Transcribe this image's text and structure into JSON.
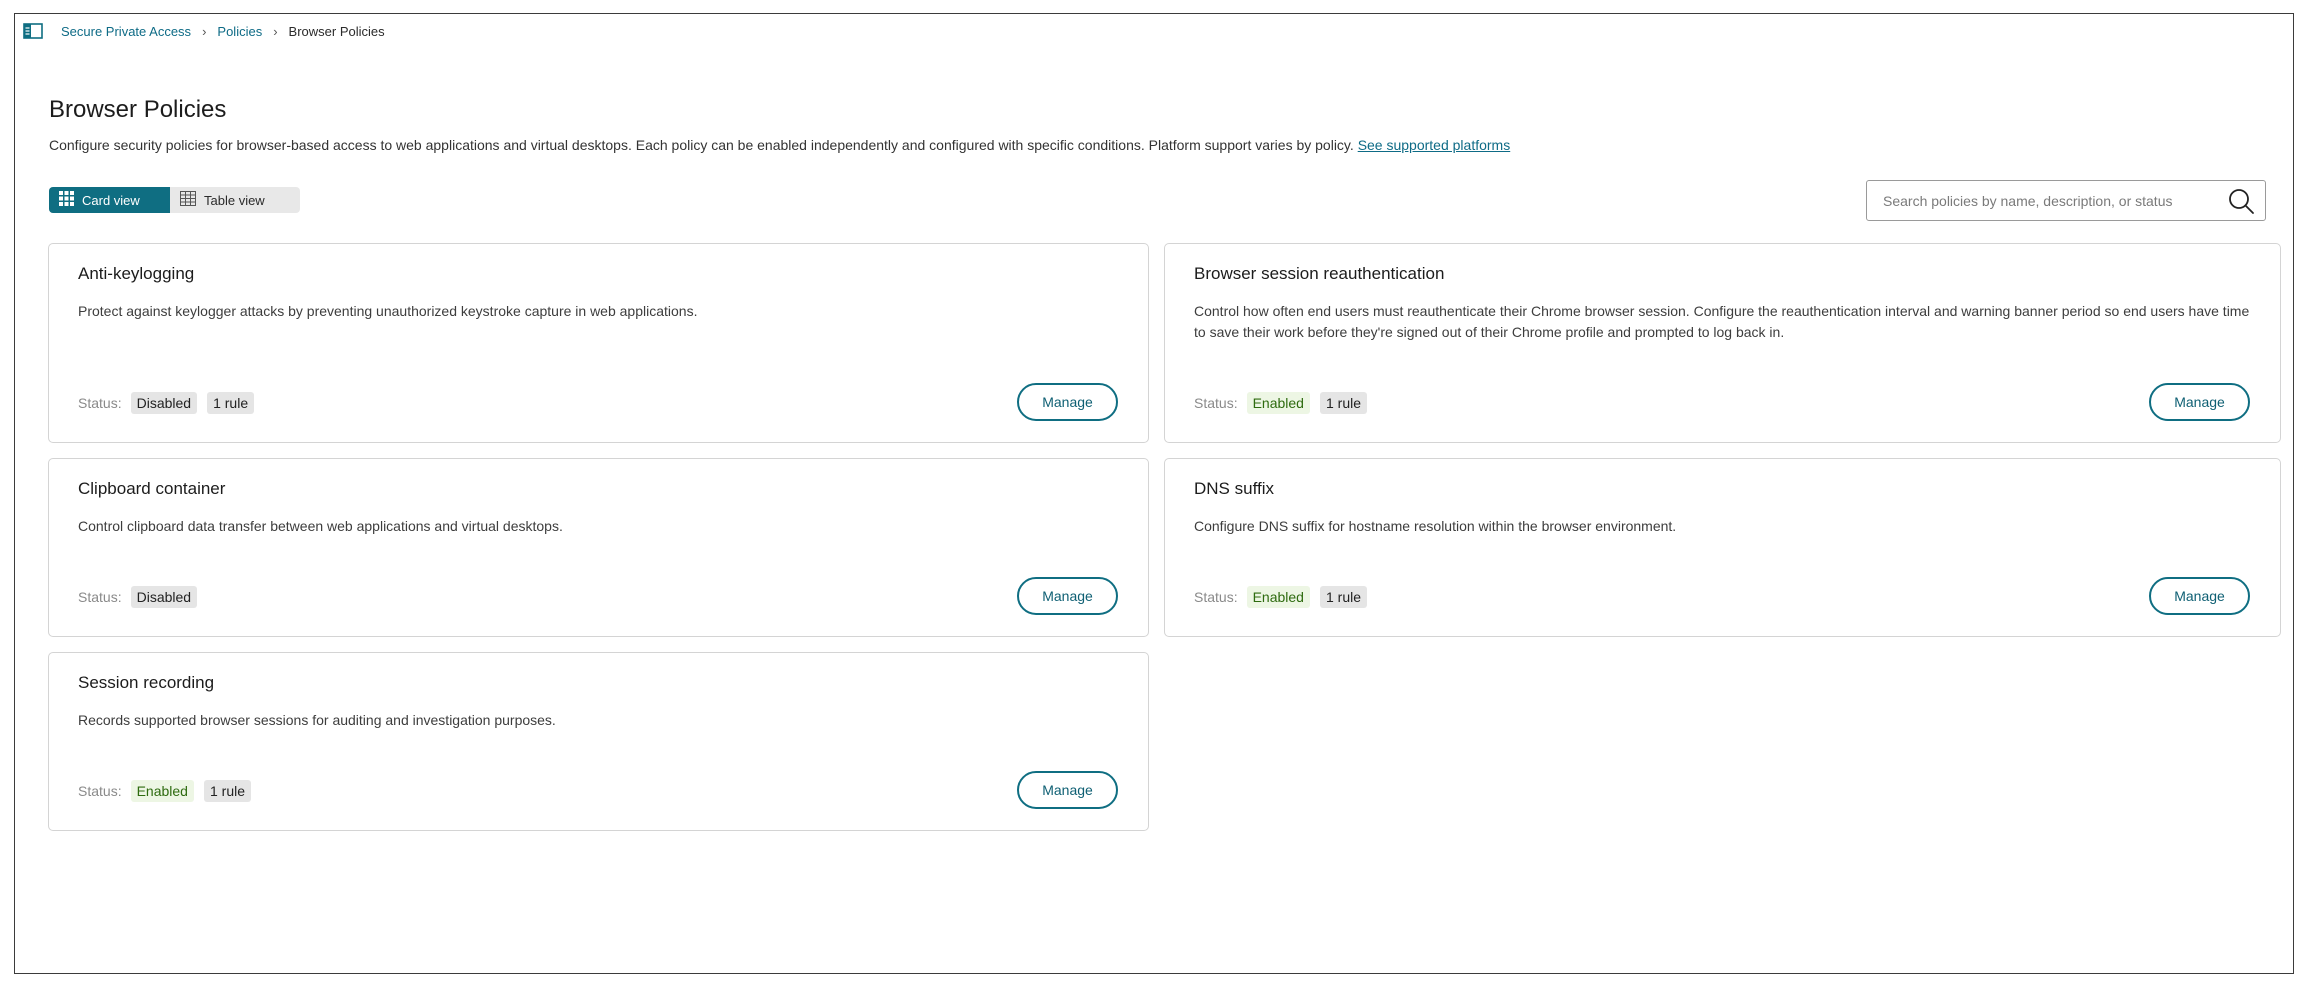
{
  "breadcrumb": {
    "items": [
      "Secure Private Access",
      "Policies"
    ],
    "current": "Browser Policies",
    "separator": "›"
  },
  "page": {
    "title": "Browser Policies",
    "description": "Configure security policies for browser-based access to web applications and virtual desktops. Each policy can be enabled independently and configured with specific conditions. Platform support varies by policy.",
    "link": "See supported platforms"
  },
  "view_toggle": {
    "card_label": "Card view",
    "table_label": "Table view",
    "selected": "Card view"
  },
  "search": {
    "placeholder": "Search policies by name, description, or status"
  },
  "status_label": "Status:",
  "manage_label": "Manage",
  "cards": [
    {
      "title": "Anti-keylogging",
      "description": "Protect against keylogger attacks by preventing unauthorized keystroke capture in web applications.",
      "status": "Disabled",
      "rules": "1 rule"
    },
    {
      "title": "Browser session reauthentication",
      "description": "Control how often end users must reauthenticate their Chrome browser session. Configure the reauthentication interval and warning banner period so end users have time to save their work before they're signed out of their Chrome profile and prompted to log back in.",
      "status": "Enabled",
      "rules": "1 rule"
    },
    {
      "title": "Clipboard container",
      "description": "Control clipboard data transfer between web applications and virtual desktops.",
      "status": "Disabled",
      "rules": ""
    },
    {
      "title": "DNS suffix",
      "description": "Configure DNS suffix for hostname resolution within the browser environment.",
      "status": "Enabled",
      "rules": "1 rule"
    },
    {
      "title": "Session recording",
      "description": "Records supported browser sessions for auditing and investigation purposes.",
      "status": "Enabled",
      "rules": "1 rule"
    }
  ],
  "colors": {
    "accent": "#0f6e82",
    "link": "#0e6b86",
    "enabled_bg": "#edf6e4",
    "enabled_text": "#2e6b0f",
    "neutral_badge": "#e5e5e5"
  }
}
